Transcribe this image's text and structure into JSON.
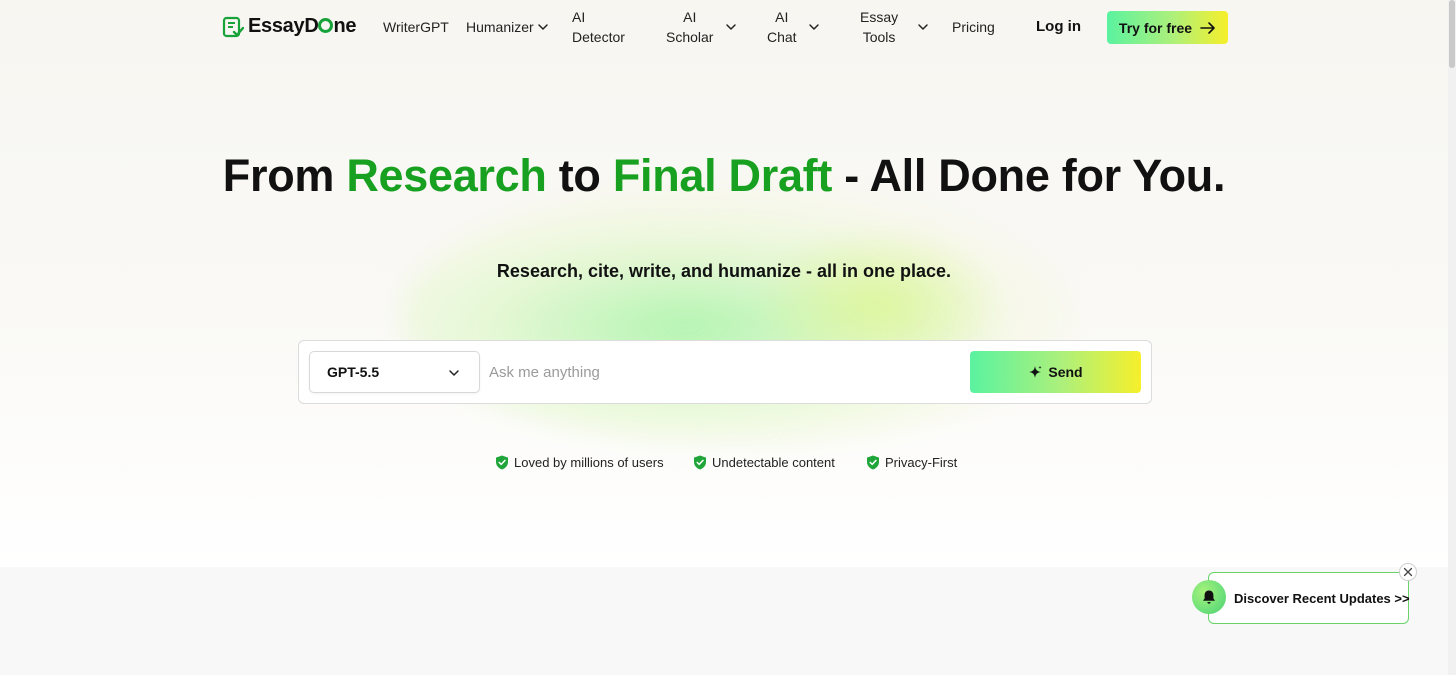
{
  "brand": {
    "name_prefix": "EssayD",
    "name_suffix": "ne",
    "accent_color": "#18a020"
  },
  "nav": {
    "items": [
      {
        "label": "WriterGPT"
      },
      {
        "label": "Humanizer"
      },
      {
        "label": "AI\nDetector"
      },
      {
        "label": "AI\nScholar"
      },
      {
        "label": "AI\nChat"
      },
      {
        "label": "Essay\nTools"
      },
      {
        "label": "Pricing"
      }
    ],
    "login_label": "Log in",
    "cta_label": "Try for free"
  },
  "hero": {
    "headline_part1": "From ",
    "headline_hl1": "Research",
    "headline_part2": " to ",
    "headline_hl2": "Final Draft",
    "headline_part3": " - All Done for You.",
    "subtitle": "Research, cite, write, and humanize - all in one place."
  },
  "search": {
    "model_value": "GPT-5.5",
    "placeholder": "Ask me anything",
    "send_label": "Send"
  },
  "features": [
    {
      "label": "Loved by millions of users"
    },
    {
      "label": "Undetectable content"
    },
    {
      "label": "Privacy-First"
    }
  ],
  "updates_popup": {
    "label": "Discover Recent Updates >>"
  },
  "icons": {
    "logo": "document-check-icon",
    "chevron": "chevron-down-icon",
    "arrow": "arrow-right-icon",
    "sparkle": "sparkle-icon",
    "shield": "shield-check-icon",
    "bell": "bell-icon",
    "close": "close-icon"
  }
}
